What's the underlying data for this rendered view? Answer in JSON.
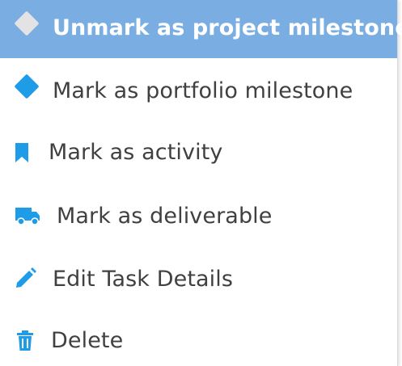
{
  "menu": {
    "items": [
      {
        "label": "Unmark as project milestone",
        "icon": "diamond-icon",
        "selected": true,
        "icon_color": "#e3e3e3"
      },
      {
        "label": "Mark as portfolio milestone",
        "icon": "diamond-icon",
        "selected": false,
        "icon_color": "#1e9ce8"
      },
      {
        "label": "Mark as activity",
        "icon": "bookmark-icon",
        "selected": false,
        "icon_color": "#1e9ce8"
      },
      {
        "label": "Mark as deliverable",
        "icon": "truck-icon",
        "selected": false,
        "icon_color": "#1e9ce8"
      },
      {
        "label": "Edit Task Details",
        "icon": "pencil-icon",
        "selected": false,
        "icon_color": "#1e9ce8"
      },
      {
        "label": "Delete",
        "icon": "trash-icon",
        "selected": false,
        "icon_color": "#1e9ce8"
      }
    ]
  },
  "colors": {
    "highlight": "#7aaee2",
    "accent": "#1e9ce8",
    "text": "#404040"
  }
}
